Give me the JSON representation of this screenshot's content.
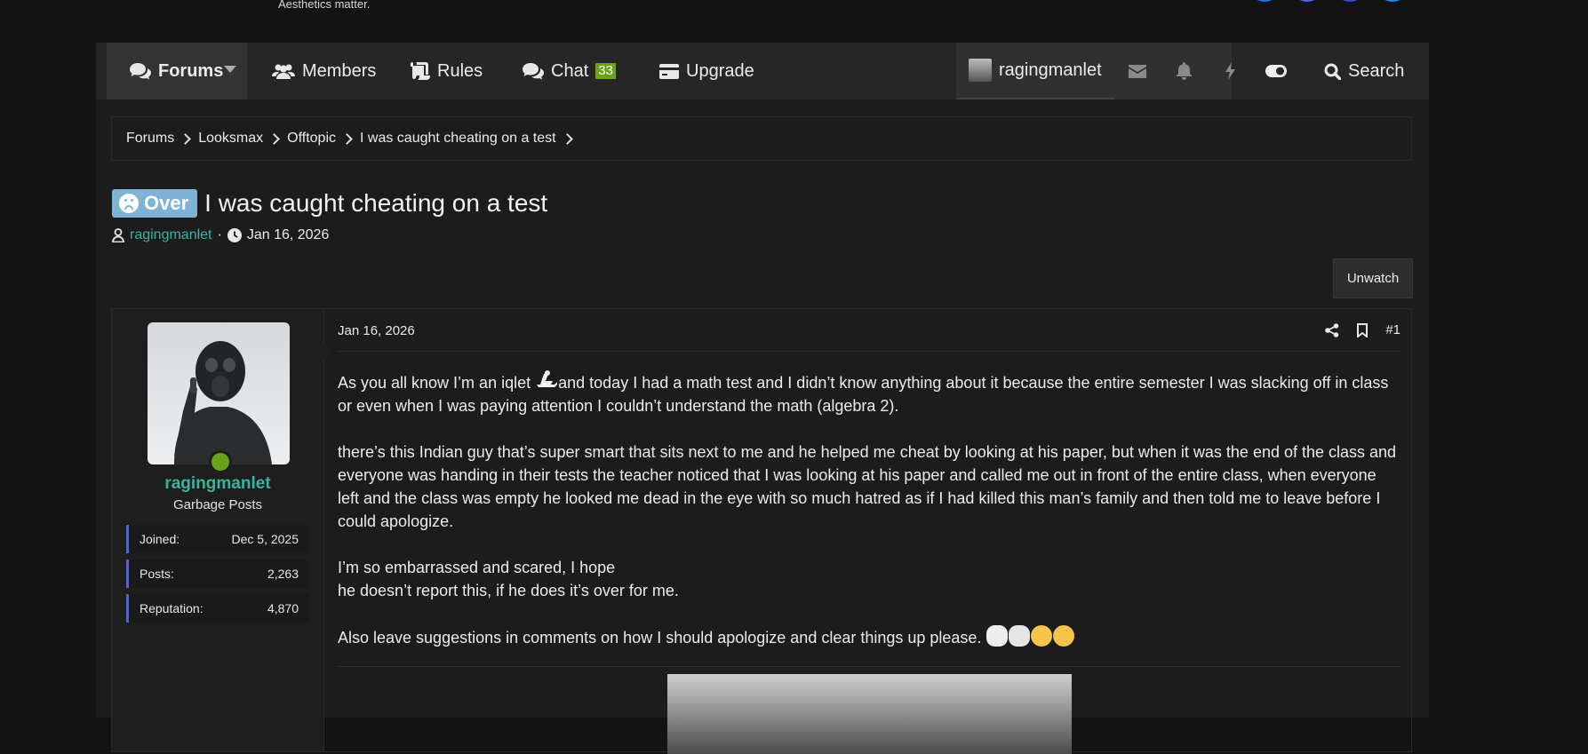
{
  "site": {
    "tagline": "Aesthetics matter."
  },
  "nav": {
    "forums": "Forums",
    "members": "Members",
    "rules": "Rules",
    "chat": "Chat",
    "chat_badge": "33",
    "upgrade": "Upgrade",
    "username": "ragingmanlet",
    "search": "Search"
  },
  "breadcrumbs": [
    "Forums",
    "Looksmax",
    "Offtopic",
    "I was caught cheating on a test"
  ],
  "thread": {
    "prefix": "Over",
    "title": "I was caught cheating on a test",
    "author": "ragingmanlet",
    "date": "Jan 16, 2026",
    "watch_button": "Unwatch"
  },
  "post": {
    "date": "Jan 16, 2026",
    "number": "#1",
    "user": {
      "name": "ragingmanlet",
      "title": "Garbage Posts",
      "stats": [
        {
          "label": "Joined:",
          "value": "Dec 5, 2025"
        },
        {
          "label": "Posts:",
          "value": "2,263"
        },
        {
          "label": "Reputation:",
          "value": "4,870"
        }
      ]
    },
    "paragraphs": [
      "As you all know I’m an iqlet",
      "and today I had a math test and I didn’t know anything about it because the entire semester I was slacking off in class or even when I was paying attention I couldn’t understand the math (algebra 2).",
      "there’s this Indian guy that’s super smart that sits next to me and he helped me cheat by looking at his paper, but when it was the end of the class and everyone was handing in their tests the teacher noticed that I was looking at his paper and called me out in front of the entire class, when everyone left and the class was empty he looked me dead in the eye with so much hatred as if I had killed this man’s family and then told me to leave before I could apologize.",
      "I’m so embarrassed and scared, I hope",
      "he doesn’t report this, if he does it’s over for me.",
      "Also leave suggestions in comments on how I should apologize and clear things up please."
    ]
  },
  "colors": {
    "accent_green": "#3cb39a",
    "prefix_blue": "#7fb3d5",
    "online": "#6aa21d",
    "stat_border": "#5a64b8"
  }
}
